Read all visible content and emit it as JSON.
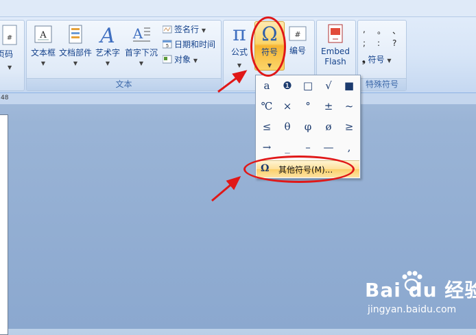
{
  "groups": {
    "text_label": "文本",
    "special_label": "特殊符号"
  },
  "buttons": {
    "page_number_partial": "页码",
    "textbox": "文本框",
    "doc_parts": "文档部件",
    "wordart": "艺术字",
    "dropcap": "首字下沉",
    "signature_line": "签名行",
    "date_time": "日期和时间",
    "object": "对象",
    "equation": "公式",
    "symbol": "符号",
    "numbering": "编号",
    "embed_flash_line1": "Embed",
    "embed_flash_line2": "Flash",
    "special_symbol": "符号"
  },
  "special_marks": [
    ",",
    "。",
    "、",
    ";",
    ":",
    "?"
  ],
  "ruler_value": "48",
  "symbols": [
    [
      "a",
      "❶",
      "□",
      "√",
      "■"
    ],
    [
      "℃",
      "×",
      "°",
      "±",
      "~"
    ],
    [
      "≤",
      "θ",
      "φ",
      "ø",
      "≥"
    ],
    [
      "→",
      "_",
      "–",
      "—",
      ","
    ]
  ],
  "more_symbols": {
    "icon": "Ω",
    "label": "其他符号(M)..."
  },
  "watermark": {
    "brand": "Bai du 经验",
    "url": "jingyan.baidu.com"
  },
  "colors": {
    "annotation_red": "#e01818",
    "highlight_orange": "#fbd56a"
  }
}
